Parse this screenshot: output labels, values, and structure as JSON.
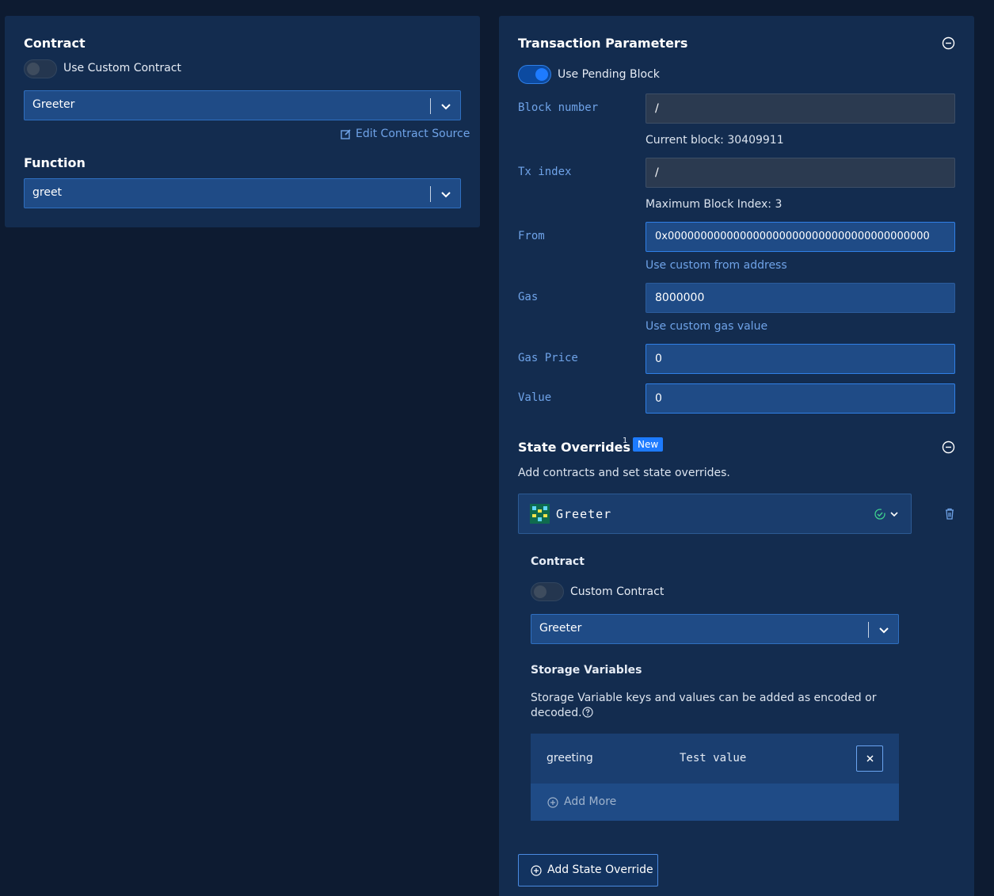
{
  "contract_panel": {
    "title": "Contract",
    "toggle_label": "Use Custom Contract",
    "toggle_on": false,
    "selected_contract": "Greeter",
    "edit_source_link": "Edit Contract Source",
    "function_title": "Function",
    "selected_function": "greet"
  },
  "tx_params": {
    "title": "Transaction Parameters",
    "pending_toggle_label": "Use Pending Block",
    "pending_toggle_on": true,
    "block_number": {
      "label": "Block number",
      "value": "/",
      "hint": "Current block: 30409911"
    },
    "tx_index": {
      "label": "Tx index",
      "value": "/",
      "hint": "Maximum Block Index: 3"
    },
    "from": {
      "label": "From",
      "value": "0x0000000000000000000000000000000000000000",
      "link": "Use custom from address"
    },
    "gas": {
      "label": "Gas",
      "value": "8000000",
      "link": "Use custom gas value"
    },
    "gas_price": {
      "label": "Gas Price",
      "value": "0"
    },
    "value": {
      "label": "Value",
      "value": "0"
    }
  },
  "state_overrides": {
    "title": "State Overrides",
    "superscript": "1",
    "badge": "New",
    "description": "Add contracts and set state overrides.",
    "override": {
      "name": "Greeter",
      "contract_title": "Contract",
      "custom_toggle_label": "Custom Contract",
      "custom_toggle_on": false,
      "selected_contract": "Greeter",
      "storage_title": "Storage Variables",
      "storage_description_1": "Storage Variable keys and values can be added as encoded or",
      "storage_description_2": "decoded.",
      "variables": [
        {
          "key": "greeting",
          "value": "Test value"
        }
      ],
      "add_more": "Add More"
    },
    "add_override_button": "Add State Override"
  },
  "colors": {
    "background": "#0d1b31",
    "panel": "#132c4f",
    "accent": "#1d7bff",
    "label": "#6fa3e8"
  }
}
